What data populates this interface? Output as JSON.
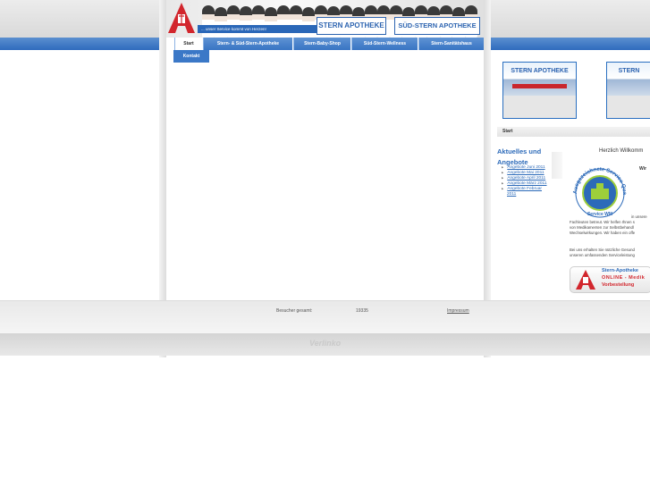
{
  "header": {
    "tagline": "... unser Service kommt von Herzen!",
    "brand_left": "STERN APOTHEKE",
    "brand_right": "SÜD-STERN APOTHEKE"
  },
  "nav": {
    "items": [
      {
        "label": "Start",
        "active": true
      },
      {
        "label": "Stern- & Süd-Stern-Apotheke"
      },
      {
        "label": "Stern-Baby-Shop"
      },
      {
        "label": "Süd-Stern-Wellness"
      },
      {
        "label": "Stern-Sanitätshaus"
      }
    ],
    "kontakt": "Kontakt"
  },
  "stores": [
    {
      "sign": "STERN APOTHEKE"
    },
    {
      "sign": "STERN"
    }
  ],
  "breadcrumb": "Start",
  "sidebar": {
    "title_line1": "Aktuelles und",
    "title_line2": "Angebote",
    "links": [
      "Angebote Juni 2011",
      "Angebote Mai 2011",
      "Angebote April 2011",
      "Angebote März 2011",
      "Angebote Februar",
      "2011"
    ]
  },
  "content": {
    "welcome": "Herzlich Willkomm",
    "wir": "Wir",
    "seal_text": "Ausgezeichnete Service Qualität",
    "seal_bottom": "Service WM",
    "lines": [
      "in unsere",
      "Fachleuten betreut. Wir helfen Ihnen s",
      "von Medikamenten zur Selbstbehandl",
      "Wechselwirkungen. Wir haben ein offe"
    ],
    "lines2": [
      "Bei uns erhalten Sie nützliche Gesund",
      "unseren umfassenden Serviceleistung"
    ]
  },
  "online_banner": {
    "line1": "Stern-Apotheke",
    "line2": "ONLINE - Medik",
    "line3": "Vorbestellung"
  },
  "footer": {
    "visitors_label": "Besucher gesamt:",
    "visitors_count": "19335",
    "impressum": "Impressum",
    "credit": "Verlinko"
  },
  "colors": {
    "accent": "#2f6bbd",
    "red": "#d2262d"
  }
}
